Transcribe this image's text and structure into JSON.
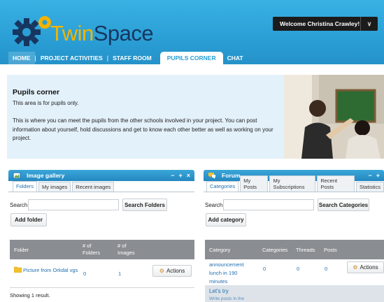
{
  "header": {
    "logo_twin": "Twin",
    "logo_space": "Space",
    "welcome": "Welcome Christina Crawley!",
    "nav": [
      "HOME",
      "PROJECT ACTIVITIES",
      "STAFF ROOM",
      "PUPILS CORNER",
      "CHAT"
    ],
    "active_nav": "PUPILS CORNER"
  },
  "intro": {
    "title": "Pupils corner",
    "subtitle": "This area is for pupils only.",
    "body": "This is where you can meet the pupils from the other schools involved in your project. You can post information about yourself, hold discussions and get to know each other better as well as working on your project."
  },
  "gallery": {
    "title": "Image gallery",
    "tabs": [
      "Folders",
      "My images",
      "Recent images"
    ],
    "search_label": "Search",
    "search_button": "Search Folders",
    "add_button": "Add folder",
    "columns": [
      "Folder",
      "# of Folders",
      "# of Images"
    ],
    "rows": [
      {
        "name": "Picture from Orkdal vgs",
        "folders": "0",
        "images": "1",
        "action": "Actions"
      }
    ],
    "footer": "Showing 1 result."
  },
  "forum": {
    "title": "Forum",
    "tabs": [
      "Categories",
      "My Posts",
      "My Subscriptions",
      "Recent Posts",
      "Statistics"
    ],
    "search_label": "Search",
    "search_button": "Search Categories",
    "add_button": "Add category",
    "columns": [
      "Category",
      "Categories",
      "Threads",
      "Posts"
    ],
    "rows": [
      {
        "name": "announcement lunch in 190 minutes",
        "categories": "0",
        "threads": "0",
        "posts": "0",
        "action": "Actions"
      },
      {
        "name": "Let's try",
        "sub": "Write posts in the"
      }
    ]
  },
  "colors": {
    "header_blue": "#2a9fd6",
    "logo_orange": "#f2b400",
    "logo_navy": "#17365f",
    "intro_bg": "#e3f1fa"
  }
}
